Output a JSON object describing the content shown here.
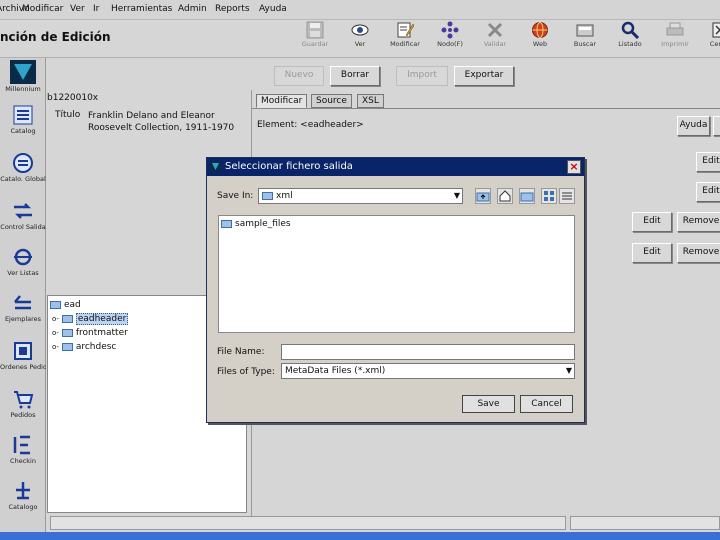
{
  "menubar": [
    "Archivo",
    "Modificar",
    "Ver",
    "Ir",
    "Herramientas",
    "Admin",
    "Reports",
    "Ayuda"
  ],
  "page_title": "nción de Edición",
  "toolbar": [
    {
      "label": "Guardar",
      "icon": "save-icon",
      "enabled": false
    },
    {
      "label": "Ver",
      "icon": "eye-icon",
      "enabled": true
    },
    {
      "label": "Modificar",
      "icon": "edit-icon",
      "enabled": true
    },
    {
      "label": "Nodo(F)",
      "icon": "node-icon",
      "enabled": true
    },
    {
      "label": "Validar",
      "icon": "validate-icon",
      "enabled": false
    },
    {
      "label": "Web",
      "icon": "globe-icon",
      "enabled": true
    },
    {
      "label": "Buscar",
      "icon": "find-icon",
      "enabled": true
    },
    {
      "label": "Listado",
      "icon": "search-icon",
      "enabled": true
    },
    {
      "label": "Imprimir",
      "icon": "print-icon",
      "enabled": false
    },
    {
      "label": "Cerrar",
      "icon": "close-icon",
      "enabled": true
    }
  ],
  "actions": {
    "nuevo": "Nuevo",
    "borrar": "Borrar",
    "import": "Import",
    "exportar": "Exportar"
  },
  "leftbar": [
    {
      "label": "Millennium",
      "icon": "logo-icon"
    },
    {
      "label": "Catalog",
      "icon": "catalog-icon"
    },
    {
      "label": "Catalo. Global",
      "icon": "global-icon"
    },
    {
      "label": "Control Salida",
      "icon": "transfer-icon"
    },
    {
      "label": "Ver Listas",
      "icon": "list-icon"
    },
    {
      "label": "Ejemplares",
      "icon": "items-icon"
    },
    {
      "label": "Ordenes Pedido",
      "icon": "orders-icon"
    },
    {
      "label": "Pedidos",
      "icon": "cart-icon"
    },
    {
      "label": "Checkin",
      "icon": "checkin-icon"
    },
    {
      "label": "Catalogo",
      "icon": "book-icon"
    }
  ],
  "record": {
    "id": "b1220010x",
    "title_label": "Título",
    "title_value": "Franklin Delano and Eleanor Roosevelt Collection, 1911-1970"
  },
  "tree": {
    "root": "ead",
    "children": [
      "eadheader",
      "frontmatter",
      "archdesc"
    ]
  },
  "right": {
    "tabs": [
      "Modificar",
      "Source",
      "XSL"
    ],
    "element": "Element: <eadheader>",
    "ayuda": "Ayuda",
    "edit": "Edit",
    "remove": "Remove"
  },
  "dialog": {
    "title": "Seleccionar fichero salida",
    "save_in_label": "Save In:",
    "save_in_value": "xml",
    "files": [
      "sample_files"
    ],
    "file_name_label": "File Name:",
    "file_name_value": "",
    "files_of_type_label": "Files of Type:",
    "files_of_type_value": "MetaData Files (*.xml)",
    "save": "Save",
    "cancel": "Cancel"
  },
  "colors": {
    "dialog_title_bg": "#0a246a",
    "taskbar": "#3a6fd8",
    "selection": "#bcd4f4"
  }
}
